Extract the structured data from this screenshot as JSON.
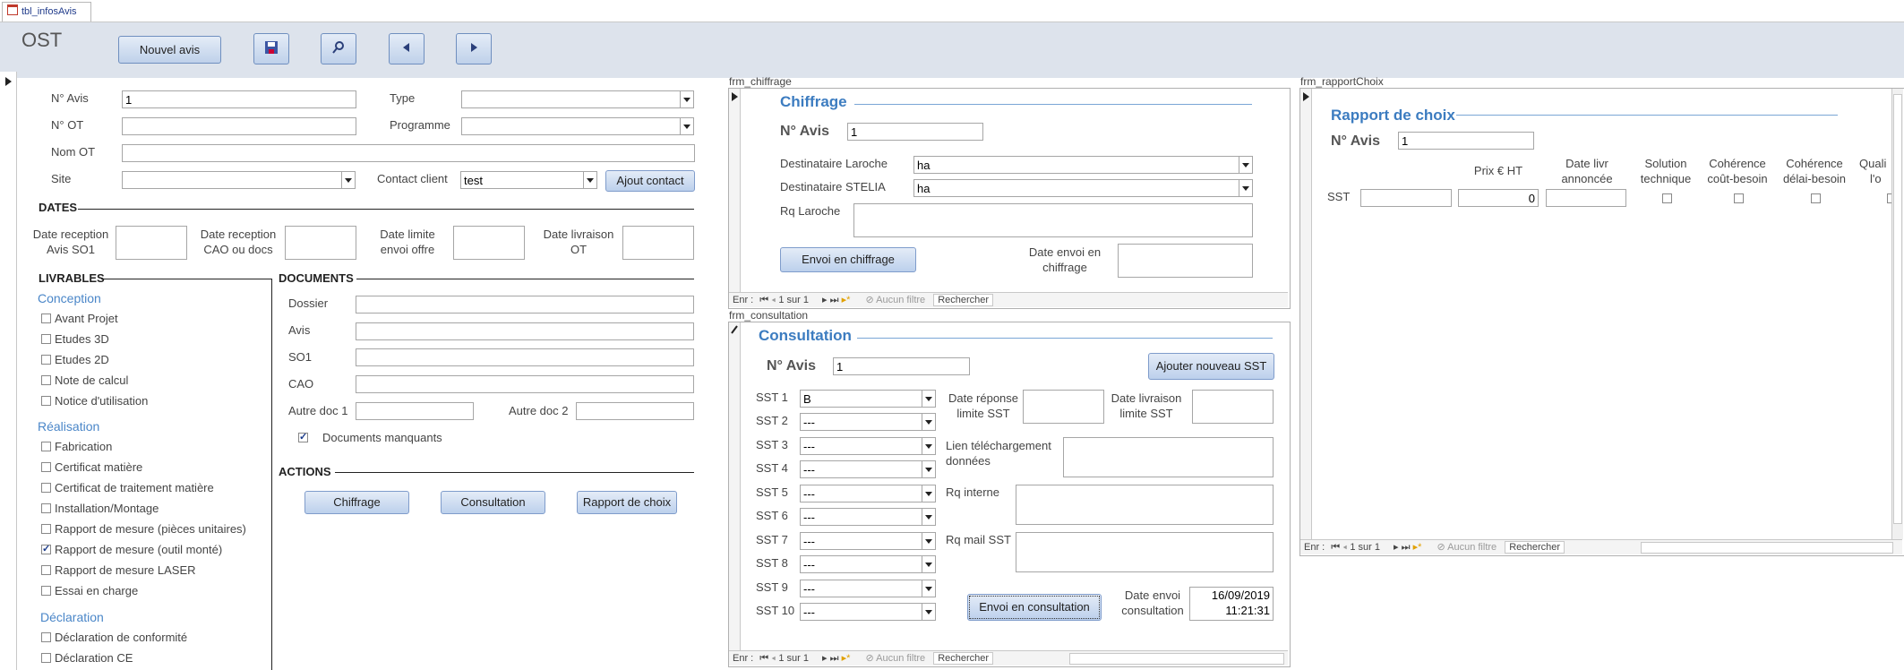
{
  "tab": {
    "label": "tbl_infosAvis"
  },
  "header": {
    "title": "OST",
    "new_button": "Nouvel avis",
    "save_icon": "save-icon",
    "search_icon": "search-icon",
    "prev_icon": "arrow-left-icon",
    "next_icon": "arrow-right-icon"
  },
  "form": {
    "num_avis_label": "N° Avis",
    "num_avis_value": "1",
    "num_ot_label": "N° OT",
    "num_ot_value": "",
    "nom_ot_label": "Nom OT",
    "nom_ot_value": "",
    "site_label": "Site",
    "site_value": "",
    "type_label": "Type",
    "type_value": "",
    "programme_label": "Programme",
    "programme_value": "",
    "contact_label": "Contact client",
    "contact_value": "test",
    "ajout_contact": "Ajout contact",
    "dates_title": "DATES",
    "date_labels": [
      {
        "l1": "Date reception",
        "l2": "Avis SO1"
      },
      {
        "l1": "Date reception",
        "l2": "CAO ou docs"
      },
      {
        "l1": "Date limite",
        "l2": "envoi offre"
      },
      {
        "l1": "Date livraison",
        "l2": "OT"
      }
    ],
    "livrables_title": "LIVRABLES",
    "groups": [
      {
        "title": "Conception",
        "items": [
          {
            "label": "Avant Projet",
            "checked": false
          },
          {
            "label": "Etudes 3D",
            "checked": false
          },
          {
            "label": "Etudes 2D",
            "checked": false
          },
          {
            "label": "Note de calcul",
            "checked": false
          },
          {
            "label": "Notice d'utilisation",
            "checked": false
          }
        ]
      },
      {
        "title": "Réalisation",
        "items": [
          {
            "label": "Fabrication",
            "checked": false
          },
          {
            "label": "Certificat matière",
            "checked": false
          },
          {
            "label": "Certificat de traitement matière",
            "checked": false
          },
          {
            "label": "Installation/Montage",
            "checked": false
          },
          {
            "label": "Rapport de mesure (pièces unitaires)",
            "checked": false
          },
          {
            "label": "Rapport de mesure (outil monté)",
            "checked": true
          },
          {
            "label": "Rapport de mesure LASER",
            "checked": false
          },
          {
            "label": "Essai en charge",
            "checked": false
          }
        ]
      },
      {
        "title": "Déclaration",
        "items": [
          {
            "label": "Déclaration de conformité",
            "checked": false
          },
          {
            "label": "Déclaration CE",
            "checked": false
          }
        ]
      }
    ],
    "documents_title": "DOCUMENTS",
    "docs": [
      "Dossier",
      "Avis",
      "SO1",
      "CAO"
    ],
    "autre_doc1": "Autre doc 1",
    "autre_doc2": "Autre doc 2",
    "docs_manquants": "Documents manquants",
    "docs_manquants_checked": true,
    "actions_title": "ACTIONS",
    "actions": [
      "Chiffrage",
      "Consultation",
      "Rapport de choix"
    ]
  },
  "chiffrage": {
    "caption": "frm_chiffrage",
    "title": "Chiffrage",
    "num_label": "N° Avis",
    "num_value": "1",
    "dest_laroche_label": "Destinataire Laroche",
    "dest_laroche_value": "ha",
    "dest_stelia_label": "Destinataire STELIA",
    "dest_stelia_value": "ha",
    "rq_laroche_label": "Rq Laroche",
    "envoi_button": "Envoi en chiffrage",
    "date_envoi_l1": "Date envoi en",
    "date_envoi_l2": "chiffrage",
    "nav": {
      "prefix": "Enr :",
      "record": "1 sur 1",
      "filter": "Aucun filtre",
      "search": "Rechercher"
    }
  },
  "consultation": {
    "caption": "frm_consultation",
    "title": "Consultation",
    "num_label": "N° Avis",
    "num_value": "1",
    "add_button": "Ajouter nouveau SST",
    "sst": [
      {
        "label": "SST 1",
        "value": "B"
      },
      {
        "label": "SST 2",
        "value": "---"
      },
      {
        "label": "SST 3",
        "value": "---"
      },
      {
        "label": "SST 4",
        "value": "---"
      },
      {
        "label": "SST 5",
        "value": "---"
      },
      {
        "label": "SST 6",
        "value": "---"
      },
      {
        "label": "SST 7",
        "value": "---"
      },
      {
        "label": "SST 8",
        "value": "---"
      },
      {
        "label": "SST 9",
        "value": "---"
      },
      {
        "label": "SST 10",
        "value": "---"
      }
    ],
    "date_reponse_l1": "Date réponse",
    "date_reponse_l2": "limite SST",
    "date_livraison_l1": "Date livraison",
    "date_livraison_l2": "limite SST",
    "lien_l1": "Lien téléchargement",
    "lien_l2": "données",
    "rq_interne": "Rq interne",
    "rq_mail": "Rq mail SST",
    "envoi_button": "Envoi en consultation",
    "date_envoi_l1": "Date envoi",
    "date_envoi_l2": "consultation",
    "date_envoi_date": "16/09/2019",
    "date_envoi_time": "11:21:31",
    "nav": {
      "prefix": "Enr :",
      "record": "1 sur 1",
      "filter": "Aucun filtre",
      "search": "Rechercher"
    }
  },
  "rapport": {
    "caption": "frm_rapportChoix",
    "title": "Rapport de choix",
    "num_label": "N° Avis",
    "num_value": "1",
    "columns": [
      {
        "l1": "Prix € HT",
        "l2": ""
      },
      {
        "l1": "Date livr",
        "l2": "annoncée"
      },
      {
        "l1": "Solution",
        "l2": "technique"
      },
      {
        "l1": "Cohérence",
        "l2": "coût-besoin"
      },
      {
        "l1": "Cohérence",
        "l2": "délai-besoin"
      },
      {
        "l1": "Quali",
        "l2": "l'o"
      }
    ],
    "row_label": "SST",
    "price_value": "0",
    "nav": {
      "prefix": "Enr :",
      "record": "1 sur 1",
      "filter": "Aucun filtre",
      "search": "Rechercher"
    }
  }
}
